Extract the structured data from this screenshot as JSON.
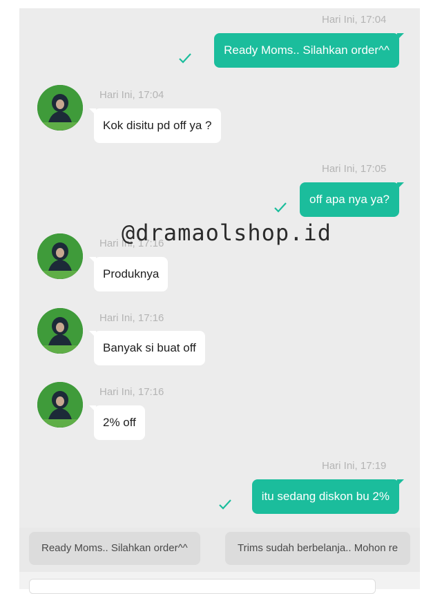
{
  "messages": [
    {
      "direction": "outgoing",
      "time": "Hari Ini, 17:04",
      "text": "Ready Moms.. Silahkan order^^"
    },
    {
      "direction": "incoming",
      "time": "Hari Ini, 17:04",
      "text": "Kok disitu pd off ya ?"
    },
    {
      "direction": "outgoing",
      "time": "Hari Ini, 17:05",
      "text": "off apa nya ya?"
    },
    {
      "direction": "incoming",
      "time": "Hari Ini, 17:16",
      "text": "Produknya"
    },
    {
      "direction": "incoming",
      "time": "Hari Ini, 17:16",
      "text": "Banyak si buat off"
    },
    {
      "direction": "incoming",
      "time": "Hari Ini, 17:16",
      "text": "2% off"
    },
    {
      "direction": "outgoing",
      "time": "Hari Ini, 17:19",
      "text": "itu sedang diskon bu 2%"
    }
  ],
  "watermark": "@dramaolshop.id",
  "quick_replies": [
    "Ready Moms.. Silahkan order^^",
    "Trims sudah berbelanja.. Mohon re"
  ],
  "icons": {
    "sent_status": "checkmark-icon",
    "avatar": "user-avatar"
  },
  "colors": {
    "outgoing_bubble": "#1bbd9c",
    "incoming_bubble": "#ffffff",
    "background": "#ececec",
    "timestamp": "#b4b4b4"
  }
}
